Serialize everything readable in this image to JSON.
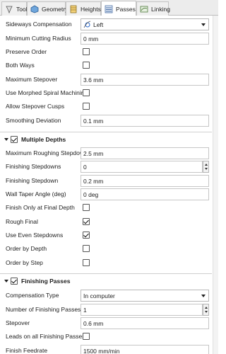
{
  "tabs": [
    {
      "label": "Tool",
      "icon": "tool-icon",
      "active": false
    },
    {
      "label": "Geometry",
      "icon": "geometry-icon",
      "active": false
    },
    {
      "label": "Heights",
      "icon": "heights-icon",
      "active": false
    },
    {
      "label": "Passes",
      "icon": "passes-icon",
      "active": true
    },
    {
      "label": "Linking",
      "icon": "linking-icon",
      "active": false
    }
  ],
  "general": {
    "sideways_compensation": {
      "label": "Sideways Compensation",
      "value": "Left",
      "icon": "left-compensation-icon"
    },
    "min_cutting_radius": {
      "label": "Minimum Cutting Radius",
      "value": "0 mm"
    },
    "preserve_order": {
      "label": "Preserve Order",
      "checked": false
    },
    "both_ways": {
      "label": "Both Ways",
      "checked": false
    },
    "max_stepover": {
      "label": "Maximum Stepover",
      "value": "3.6 mm"
    },
    "morphed_spiral": {
      "label": "Use Morphed Spiral Machining",
      "checked": false
    },
    "stepover_cusps": {
      "label": "Allow Stepover Cusps",
      "checked": false
    },
    "smoothing_deviation": {
      "label": "Smoothing Deviation",
      "value": "0.1 mm"
    }
  },
  "multiple_depths": {
    "title": "Multiple Depths",
    "checked": true,
    "max_roughing_stepdown": {
      "label": "Maximum Roughing Stepdown",
      "value": "2.5 mm"
    },
    "finishing_stepdowns": {
      "label": "Finishing Stepdowns",
      "value": "0"
    },
    "finishing_stepdown": {
      "label": "Finishing Stepdown",
      "value": "0.2 mm"
    },
    "wall_taper_angle": {
      "label": "Wall Taper Angle (deg)",
      "value": "0 deg"
    },
    "finish_only_final": {
      "label": "Finish Only at Final Depth",
      "checked": false
    },
    "rough_final": {
      "label": "Rough Final",
      "checked": true
    },
    "even_stepdowns": {
      "label": "Use Even Stepdowns",
      "checked": true
    },
    "order_by_depth": {
      "label": "Order by Depth",
      "checked": false
    },
    "order_by_step": {
      "label": "Order by Step",
      "checked": false
    }
  },
  "finishing_passes": {
    "title": "Finishing Passes",
    "checked": true,
    "compensation_type": {
      "label": "Compensation Type",
      "value": "In computer"
    },
    "num_finishing_passes": {
      "label": "Number of Finishing Passes",
      "value": "1"
    },
    "stepover": {
      "label": "Stepover",
      "value": "0.6 mm"
    },
    "leads_on_all": {
      "label": "Leads on all Finishing Passes",
      "checked": false
    },
    "finish_feedrate": {
      "label": "Finish Feedrate",
      "value": "1500 mm/min"
    }
  },
  "colors": {
    "check": "#111111",
    "section_divider": "#cfcfcf",
    "tab_active": "#ffffff"
  }
}
